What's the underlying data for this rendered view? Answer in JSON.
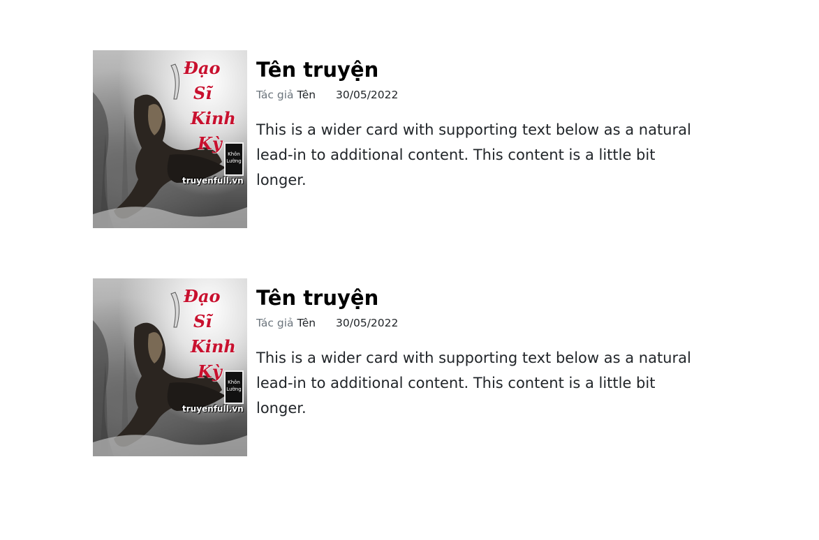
{
  "stories": [
    {
      "cover": {
        "title_lines": [
          "Đạo",
          "Sĩ",
          "Kinh",
          "Kỳ"
        ],
        "seal_text": "Khôn Lường",
        "site": "truyenfull.vn"
      },
      "title": "Tên truyện",
      "author_label": "Tác giả",
      "author": "Tên",
      "date": "30/05/2022",
      "description": "This is a wider card with supporting text below as a natural lead-in to additional content. This content is a little bit longer."
    },
    {
      "cover": {
        "title_lines": [
          "Đạo",
          "Sĩ",
          "Kinh",
          "Kỳ"
        ],
        "seal_text": "Khôn Lường",
        "site": "truyenfull.vn"
      },
      "title": "Tên truyện",
      "author_label": "Tác giả",
      "author": "Tên",
      "date": "30/05/2022",
      "description": "This is a wider card with supporting text below as a natural lead-in to additional content. This content is a little bit longer."
    }
  ]
}
